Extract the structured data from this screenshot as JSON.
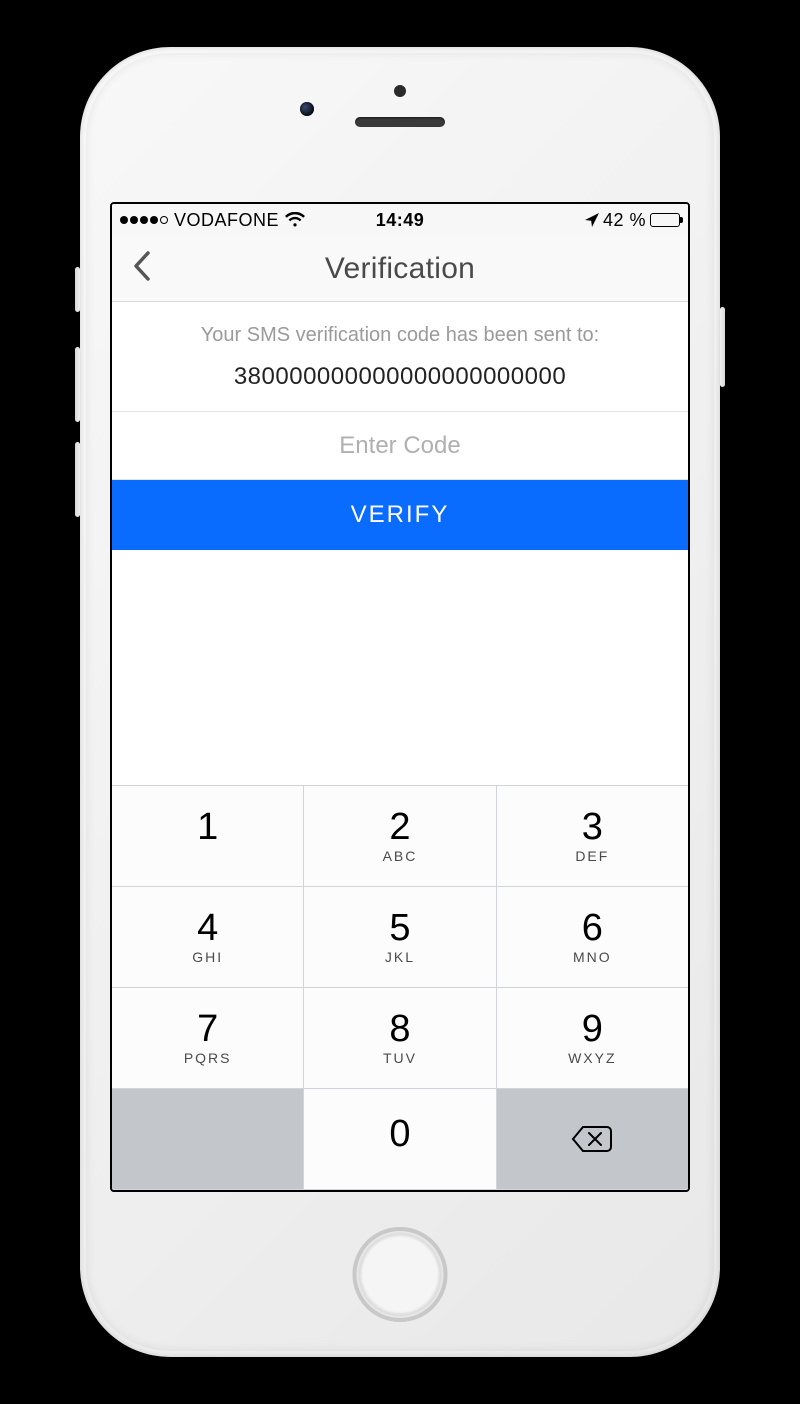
{
  "status_bar": {
    "carrier": "VODAFONE",
    "time": "14:49",
    "battery_text": "42 %"
  },
  "header": {
    "title": "Verification"
  },
  "content": {
    "info_text": "Your SMS verification code has been sent to:",
    "phone_number": "380000000000000000000000",
    "code_placeholder": "Enter Code",
    "verify_label": "VERIFY"
  },
  "keypad": {
    "keys": [
      [
        {
          "digit": "1",
          "letters": ""
        },
        {
          "digit": "2",
          "letters": "ABC"
        },
        {
          "digit": "3",
          "letters": "DEF"
        }
      ],
      [
        {
          "digit": "4",
          "letters": "GHI"
        },
        {
          "digit": "5",
          "letters": "JKL"
        },
        {
          "digit": "6",
          "letters": "MNO"
        }
      ],
      [
        {
          "digit": "7",
          "letters": "PQRS"
        },
        {
          "digit": "8",
          "letters": "TUV"
        },
        {
          "digit": "9",
          "letters": "WXYZ"
        }
      ],
      [
        {
          "digit": "",
          "letters": ""
        },
        {
          "digit": "0",
          "letters": ""
        },
        {
          "digit": "",
          "letters": ""
        }
      ]
    ]
  }
}
